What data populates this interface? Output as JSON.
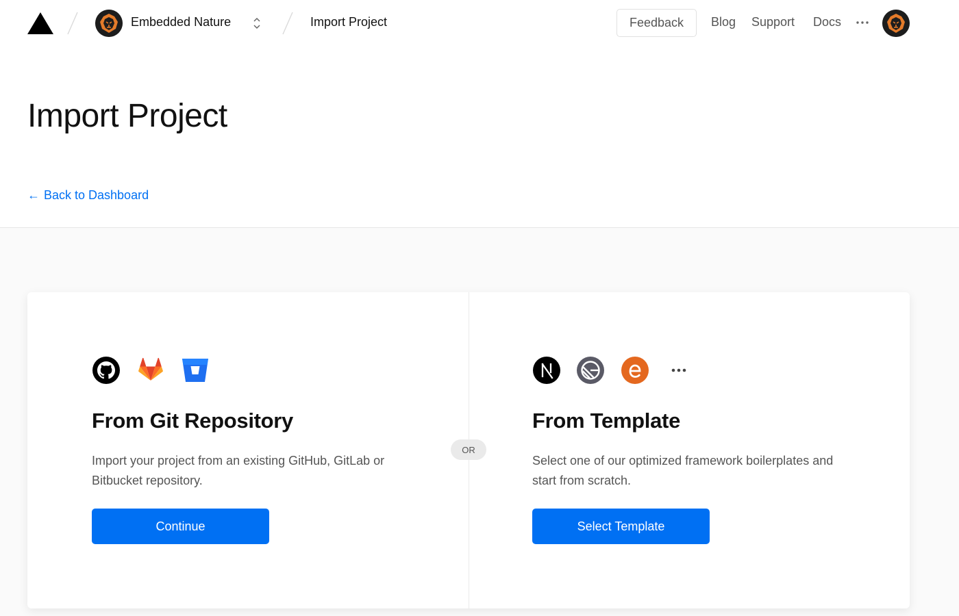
{
  "header": {
    "logo_icon": "triangle-logo-icon",
    "team": {
      "name": "Embedded Nature",
      "avatar_icon": "lion-avatar-icon"
    },
    "breadcrumb": "Import Project",
    "feedback_label": "Feedback",
    "nav": [
      "Blog",
      "Support",
      "Docs"
    ],
    "more_icon": "ellipsis-icon",
    "user_avatar_icon": "lion-avatar-icon"
  },
  "page": {
    "title": "Import Project",
    "back_link": "Back to Dashboard",
    "back_icon": "arrow-left-icon"
  },
  "or_label": "OR",
  "git_option": {
    "icons": [
      "github-icon",
      "gitlab-icon",
      "bitbucket-icon"
    ],
    "title": "From Git Repository",
    "description": "Import your project from an existing GitHub, GitLab or Bitbucket repository.",
    "button_label": "Continue"
  },
  "template_option": {
    "icons": [
      "nextjs-icon",
      "gatsby-icon",
      "eleventy-icon",
      "more-templates-icon"
    ],
    "title": "From Template",
    "description": "Select one of our optimized framework boilerplates and start from scratch.",
    "button_label": "Select Template"
  },
  "colors": {
    "accent": "#0070f3",
    "gitlab": "#e2672c",
    "bitbucket": "#1f6ff0",
    "gatsby_bg": "#5a5a66",
    "eleventy_bg": "#e4681f",
    "avatar_orange": "#e47b2a"
  }
}
